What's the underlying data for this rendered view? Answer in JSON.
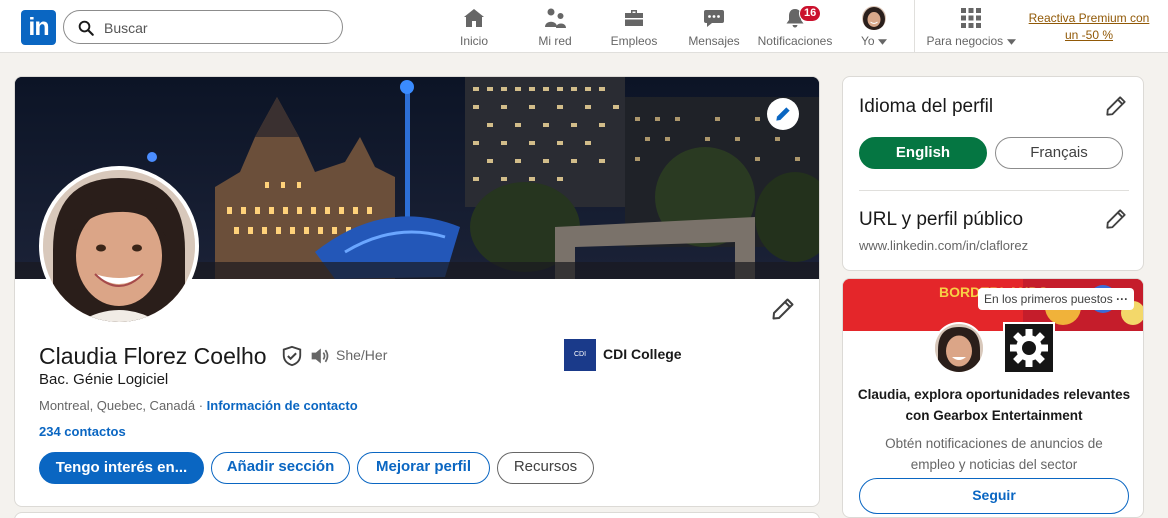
{
  "nav": {
    "logo": "in",
    "search_placeholder": "Buscar",
    "items": [
      {
        "label": "Inicio",
        "icon": "home-icon"
      },
      {
        "label": "Mi red",
        "icon": "network-icon"
      },
      {
        "label": "Empleos",
        "icon": "briefcase-icon"
      },
      {
        "label": "Mensajes",
        "icon": "messaging-icon"
      },
      {
        "label": "Notificaciones",
        "icon": "bell-icon",
        "badge": "16"
      },
      {
        "label": "Yo",
        "icon": "avatar"
      }
    ],
    "business_label": "Para negocios",
    "premium_label": "Reactiva Premium con un -50 %"
  },
  "profile": {
    "name": "Claudia Florez Coelho",
    "pronouns": "She/Her",
    "headline": "Bac. Génie Logiciel",
    "location": "Montreal, Quebec, Canadá ·",
    "contact_info": "Información de contacto",
    "connections": "234 contactos",
    "school_logo_text": "CDI college",
    "school": "CDI College",
    "buttons": {
      "open_to": "Tengo interés en...",
      "add_section": "Añadir sección",
      "enhance": "Mejorar perfil",
      "resources": "Recursos"
    }
  },
  "sidebar": {
    "language_title": "Idioma del perfil",
    "lang_options": [
      "English",
      "Français"
    ],
    "url_title": "URL y perfil público",
    "url": "www.linkedin.com/in/claflorez"
  },
  "ad": {
    "tag": "En los primeros puestos",
    "banner_text": "BORDERLANDS",
    "title": "Claudia, explora oportunidades relevantes con Gearbox Entertainment",
    "text": "Obtén notificaciones de anuncios de empleo y noticias del sector",
    "follow": "Seguir"
  },
  "colors": {
    "brand": "#0a66c2",
    "premium": "#915907",
    "active_lang": "#057642",
    "badge": "#cb112d"
  }
}
